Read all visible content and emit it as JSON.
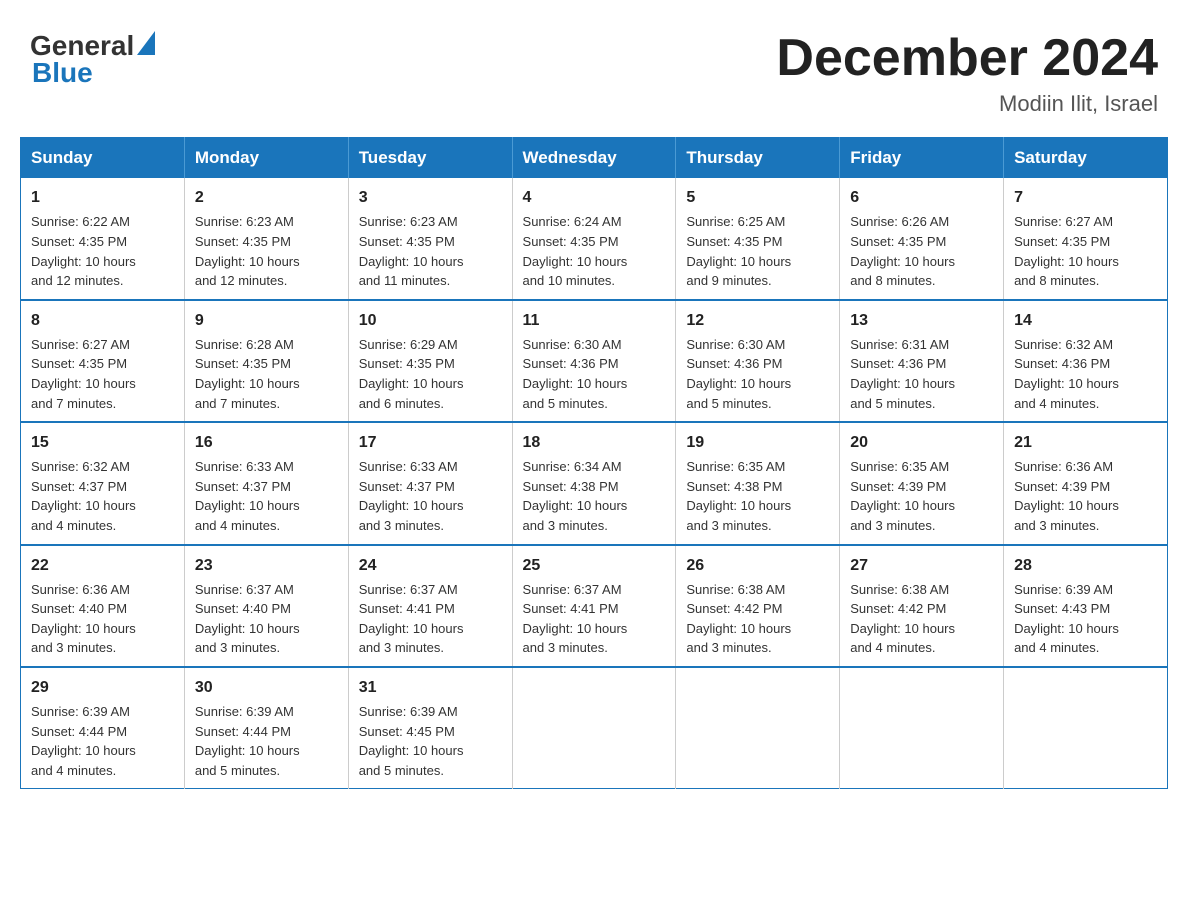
{
  "header": {
    "logo_general": "General",
    "logo_blue": "Blue",
    "month_title": "December 2024",
    "location": "Modiin Ilit, Israel"
  },
  "weekdays": [
    "Sunday",
    "Monday",
    "Tuesday",
    "Wednesday",
    "Thursday",
    "Friday",
    "Saturday"
  ],
  "weeks": [
    [
      {
        "day": "1",
        "sunrise": "6:22 AM",
        "sunset": "4:35 PM",
        "daylight": "10 hours and 12 minutes."
      },
      {
        "day": "2",
        "sunrise": "6:23 AM",
        "sunset": "4:35 PM",
        "daylight": "10 hours and 12 minutes."
      },
      {
        "day": "3",
        "sunrise": "6:23 AM",
        "sunset": "4:35 PM",
        "daylight": "10 hours and 11 minutes."
      },
      {
        "day": "4",
        "sunrise": "6:24 AM",
        "sunset": "4:35 PM",
        "daylight": "10 hours and 10 minutes."
      },
      {
        "day": "5",
        "sunrise": "6:25 AM",
        "sunset": "4:35 PM",
        "daylight": "10 hours and 9 minutes."
      },
      {
        "day": "6",
        "sunrise": "6:26 AM",
        "sunset": "4:35 PM",
        "daylight": "10 hours and 8 minutes."
      },
      {
        "day": "7",
        "sunrise": "6:27 AM",
        "sunset": "4:35 PM",
        "daylight": "10 hours and 8 minutes."
      }
    ],
    [
      {
        "day": "8",
        "sunrise": "6:27 AM",
        "sunset": "4:35 PM",
        "daylight": "10 hours and 7 minutes."
      },
      {
        "day": "9",
        "sunrise": "6:28 AM",
        "sunset": "4:35 PM",
        "daylight": "10 hours and 7 minutes."
      },
      {
        "day": "10",
        "sunrise": "6:29 AM",
        "sunset": "4:35 PM",
        "daylight": "10 hours and 6 minutes."
      },
      {
        "day": "11",
        "sunrise": "6:30 AM",
        "sunset": "4:36 PM",
        "daylight": "10 hours and 5 minutes."
      },
      {
        "day": "12",
        "sunrise": "6:30 AM",
        "sunset": "4:36 PM",
        "daylight": "10 hours and 5 minutes."
      },
      {
        "day": "13",
        "sunrise": "6:31 AM",
        "sunset": "4:36 PM",
        "daylight": "10 hours and 5 minutes."
      },
      {
        "day": "14",
        "sunrise": "6:32 AM",
        "sunset": "4:36 PM",
        "daylight": "10 hours and 4 minutes."
      }
    ],
    [
      {
        "day": "15",
        "sunrise": "6:32 AM",
        "sunset": "4:37 PM",
        "daylight": "10 hours and 4 minutes."
      },
      {
        "day": "16",
        "sunrise": "6:33 AM",
        "sunset": "4:37 PM",
        "daylight": "10 hours and 4 minutes."
      },
      {
        "day": "17",
        "sunrise": "6:33 AM",
        "sunset": "4:37 PM",
        "daylight": "10 hours and 3 minutes."
      },
      {
        "day": "18",
        "sunrise": "6:34 AM",
        "sunset": "4:38 PM",
        "daylight": "10 hours and 3 minutes."
      },
      {
        "day": "19",
        "sunrise": "6:35 AM",
        "sunset": "4:38 PM",
        "daylight": "10 hours and 3 minutes."
      },
      {
        "day": "20",
        "sunrise": "6:35 AM",
        "sunset": "4:39 PM",
        "daylight": "10 hours and 3 minutes."
      },
      {
        "day": "21",
        "sunrise": "6:36 AM",
        "sunset": "4:39 PM",
        "daylight": "10 hours and 3 minutes."
      }
    ],
    [
      {
        "day": "22",
        "sunrise": "6:36 AM",
        "sunset": "4:40 PM",
        "daylight": "10 hours and 3 minutes."
      },
      {
        "day": "23",
        "sunrise": "6:37 AM",
        "sunset": "4:40 PM",
        "daylight": "10 hours and 3 minutes."
      },
      {
        "day": "24",
        "sunrise": "6:37 AM",
        "sunset": "4:41 PM",
        "daylight": "10 hours and 3 minutes."
      },
      {
        "day": "25",
        "sunrise": "6:37 AM",
        "sunset": "4:41 PM",
        "daylight": "10 hours and 3 minutes."
      },
      {
        "day": "26",
        "sunrise": "6:38 AM",
        "sunset": "4:42 PM",
        "daylight": "10 hours and 3 minutes."
      },
      {
        "day": "27",
        "sunrise": "6:38 AM",
        "sunset": "4:42 PM",
        "daylight": "10 hours and 4 minutes."
      },
      {
        "day": "28",
        "sunrise": "6:39 AM",
        "sunset": "4:43 PM",
        "daylight": "10 hours and 4 minutes."
      }
    ],
    [
      {
        "day": "29",
        "sunrise": "6:39 AM",
        "sunset": "4:44 PM",
        "daylight": "10 hours and 4 minutes."
      },
      {
        "day": "30",
        "sunrise": "6:39 AM",
        "sunset": "4:44 PM",
        "daylight": "10 hours and 5 minutes."
      },
      {
        "day": "31",
        "sunrise": "6:39 AM",
        "sunset": "4:45 PM",
        "daylight": "10 hours and 5 minutes."
      },
      null,
      null,
      null,
      null
    ]
  ],
  "labels": {
    "sunrise": "Sunrise:",
    "sunset": "Sunset:",
    "daylight": "Daylight:"
  }
}
